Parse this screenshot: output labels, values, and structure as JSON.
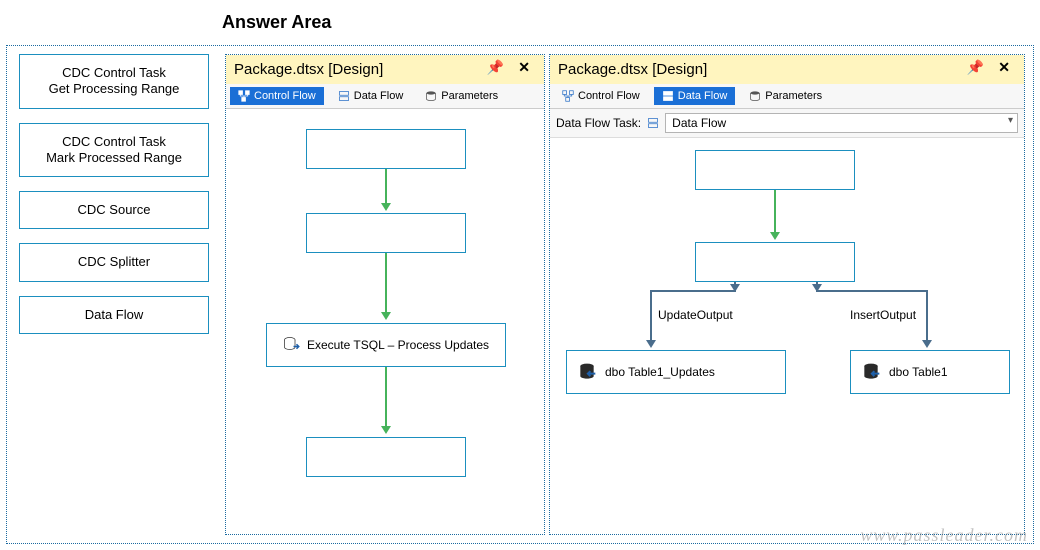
{
  "heading": "Answer Area",
  "source_items": [
    "CDC Control Task\nGet Processing Range",
    "CDC Control Task\nMark Processed Range",
    "CDC Source",
    "CDC Splitter",
    "Data Flow"
  ],
  "panel_left": {
    "title": "Package.dtsx [Design]",
    "tabs": {
      "control_flow": "Control Flow",
      "data_flow": "Data Flow",
      "parameters": "Parameters"
    },
    "active_tab": "control_flow",
    "nodes": {
      "slot1": "",
      "slot2": "",
      "exec_tsql": "Execute TSQL – Process Updates",
      "slot4": ""
    }
  },
  "panel_right": {
    "title": "Package.dtsx [Design]",
    "tabs": {
      "control_flow": "Control Flow",
      "data_flow": "Data Flow",
      "parameters": "Parameters"
    },
    "active_tab": "data_flow",
    "data_flow_task_label": "Data Flow Task:",
    "data_flow_task_value": "Data Flow",
    "nodes": {
      "slot1": "",
      "slot2": "",
      "dest_updates": "dbo Table1_Updates",
      "dest_insert": "dbo Table1"
    },
    "edges": {
      "update": "UpdateOutput",
      "insert": "InsertOutput"
    }
  },
  "watermark": "www.passleader.com"
}
